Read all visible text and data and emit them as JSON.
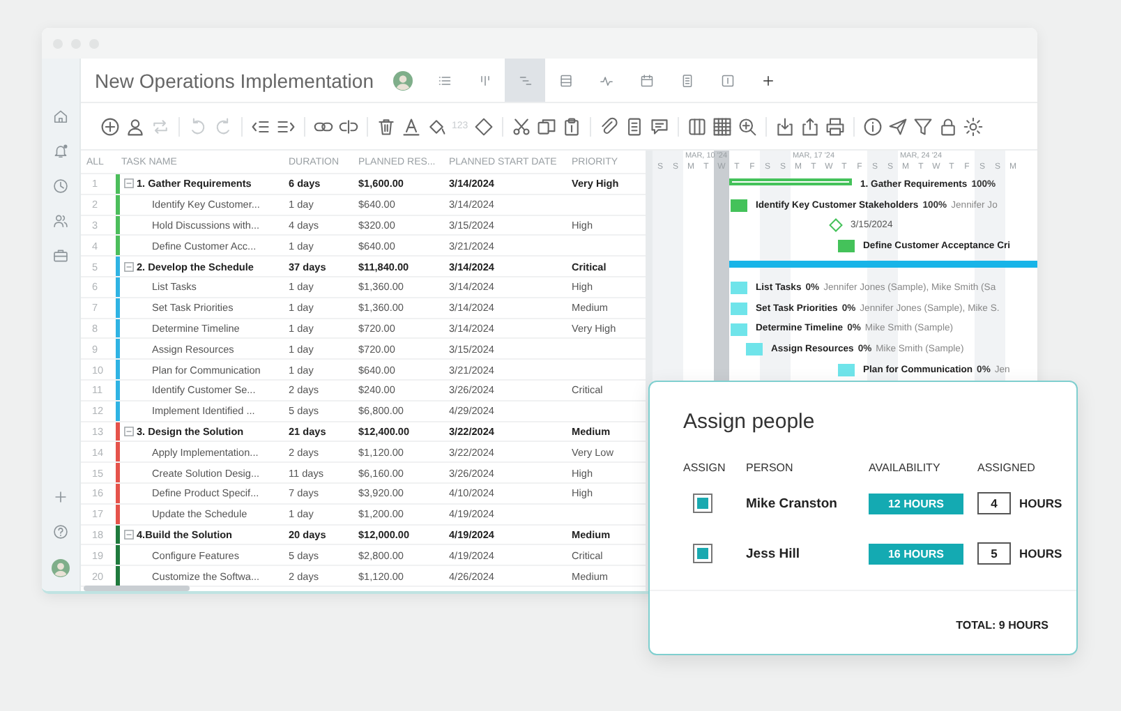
{
  "window": {
    "title": "New Operations Implementation"
  },
  "sidebar": {
    "items": [
      {
        "kind": "home"
      },
      {
        "kind": "bell"
      },
      {
        "kind": "clock"
      },
      {
        "kind": "people"
      },
      {
        "kind": "briefcase"
      }
    ],
    "bottom": [
      {
        "kind": "plus"
      },
      {
        "kind": "help"
      },
      {
        "kind": "avatar"
      }
    ]
  },
  "views": [
    {
      "kind": "list",
      "selected": false
    },
    {
      "kind": "board",
      "selected": false
    },
    {
      "kind": "gantt",
      "selected": true
    },
    {
      "kind": "sheet",
      "selected": false
    },
    {
      "kind": "pulse",
      "selected": false
    },
    {
      "kind": "calendar",
      "selected": false
    },
    {
      "kind": "doc",
      "selected": false
    },
    {
      "kind": "panel",
      "selected": false
    },
    {
      "kind": "plus",
      "selected": false
    }
  ],
  "toolbar": [
    [
      {
        "kind": "add",
        "disabled": false
      },
      {
        "kind": "person",
        "disabled": false
      },
      {
        "kind": "repeat",
        "disabled": true
      }
    ],
    [
      {
        "kind": "undo",
        "disabled": true
      },
      {
        "kind": "redo",
        "disabled": true
      }
    ],
    [
      {
        "kind": "outdent",
        "disabled": false
      },
      {
        "kind": "indent",
        "disabled": false
      }
    ],
    [
      {
        "kind": "link",
        "disabled": false
      },
      {
        "kind": "unlink",
        "disabled": false
      }
    ],
    [
      {
        "kind": "trash",
        "disabled": false
      },
      {
        "kind": "text",
        "disabled": false
      },
      {
        "kind": "bucket",
        "disabled": false
      },
      {
        "kind": "number",
        "label": "123",
        "disabled": true
      },
      {
        "kind": "diamond",
        "disabled": false
      }
    ],
    [
      {
        "kind": "scissors",
        "disabled": false
      },
      {
        "kind": "copy",
        "disabled": false
      },
      {
        "kind": "paste",
        "disabled": false
      }
    ],
    [
      {
        "kind": "attach",
        "disabled": false
      },
      {
        "kind": "doc",
        "disabled": false
      },
      {
        "kind": "comment",
        "disabled": false
      }
    ],
    [
      {
        "kind": "columns",
        "disabled": false
      },
      {
        "kind": "grid",
        "disabled": false
      },
      {
        "kind": "zoom",
        "disabled": false
      }
    ],
    [
      {
        "kind": "import",
        "disabled": false
      },
      {
        "kind": "export",
        "disabled": false
      },
      {
        "kind": "print",
        "disabled": false
      }
    ],
    [
      {
        "kind": "info",
        "disabled": false
      },
      {
        "kind": "send",
        "disabled": false
      },
      {
        "kind": "filter",
        "disabled": false
      },
      {
        "kind": "lock",
        "disabled": false
      },
      {
        "kind": "settings",
        "disabled": false
      }
    ]
  ],
  "table": {
    "columns": [
      "ALL",
      "TASK NAME",
      "DURATION",
      "PLANNED RES...",
      "PLANNED START DATE",
      "PRIORITY"
    ],
    "groups": [
      {
        "num": "1",
        "name": "1. Gather Requirements",
        "duration": "6 days",
        "cost": "$1,600.00",
        "start": "3/14/2024",
        "priority": "Very High",
        "color": "#4cbe5c",
        "expanded": true,
        "children": [
          {
            "num": "2",
            "name": "Identify Key Customer...",
            "duration": "1 day",
            "cost": "$640.00",
            "start": "3/14/2024"
          },
          {
            "num": "3",
            "name": "Hold Discussions with...",
            "duration": "4 days",
            "cost": "$320.00",
            "start": "3/15/2024",
            "priority": "High"
          },
          {
            "num": "4",
            "name": "Define Customer Acc...",
            "duration": "1 day",
            "cost": "$640.00",
            "start": "3/21/2024"
          }
        ]
      },
      {
        "num": "5",
        "name": "2. Develop the Schedule",
        "duration": "37 days",
        "cost": "$11,840.00",
        "start": "3/14/2024",
        "priority": "Critical",
        "color": "#2fb3e3",
        "expanded": true,
        "children": [
          {
            "num": "6",
            "name": "List Tasks",
            "duration": "1 day",
            "cost": "$1,360.00",
            "start": "3/14/2024",
            "priority": "High"
          },
          {
            "num": "7",
            "name": "Set Task Priorities",
            "duration": "1 day",
            "cost": "$1,360.00",
            "start": "3/14/2024",
            "priority": "Medium"
          },
          {
            "num": "8",
            "name": "Determine Timeline",
            "duration": "1 day",
            "cost": "$720.00",
            "start": "3/14/2024",
            "priority": "Very High"
          },
          {
            "num": "9",
            "name": "Assign Resources",
            "duration": "1 day",
            "cost": "$720.00",
            "start": "3/15/2024"
          },
          {
            "num": "10",
            "name": "Plan for Communication",
            "duration": "1 day",
            "cost": "$640.00",
            "start": "3/21/2024"
          },
          {
            "num": "11",
            "name": "Identify Customer Se...",
            "duration": "2 days",
            "cost": "$240.00",
            "start": "3/26/2024",
            "priority": "Critical"
          },
          {
            "num": "12",
            "name": "Implement Identified ...",
            "duration": "5 days",
            "cost": "$6,800.00",
            "start": "4/29/2024"
          }
        ]
      },
      {
        "num": "13",
        "name": "3. Design the Solution",
        "duration": "21 days",
        "cost": "$12,400.00",
        "start": "3/22/2024",
        "priority": "Medium",
        "color": "#e5534b",
        "expanded": true,
        "children": [
          {
            "num": "14",
            "name": "Apply Implementation...",
            "duration": "2 days",
            "cost": "$1,120.00",
            "start": "3/22/2024",
            "priority": "Very Low"
          },
          {
            "num": "15",
            "name": "Create Solution Desig...",
            "duration": "11 days",
            "cost": "$6,160.00",
            "start": "3/26/2024",
            "priority": "High"
          },
          {
            "num": "16",
            "name": "Define Product Specif...",
            "duration": "7 days",
            "cost": "$3,920.00",
            "start": "4/10/2024",
            "priority": "High"
          },
          {
            "num": "17",
            "name": "Update the Schedule",
            "duration": "1 day",
            "cost": "$1,200.00",
            "start": "4/19/2024"
          }
        ]
      },
      {
        "num": "18",
        "name": "4.Build the Solution",
        "duration": "20 days",
        "cost": "$12,000.00",
        "start": "4/19/2024",
        "priority": "Medium",
        "color": "#1f7a3d",
        "expanded": true,
        "children": [
          {
            "num": "19",
            "name": "Configure Features",
            "duration": "5 days",
            "cost": "$2,800.00",
            "start": "4/19/2024",
            "priority": "Critical"
          },
          {
            "num": "20",
            "name": "Customize the Softwa...",
            "duration": "2 days",
            "cost": "$1,120.00",
            "start": "4/26/2024",
            "priority": "Medium"
          }
        ]
      }
    ]
  },
  "gantt": {
    "weeks": [
      "MAR, 10 '24",
      "MAR, 17 '24",
      "MAR, 24 '24"
    ],
    "days": [
      {
        "label": "S",
        "weekend": true,
        "today": false
      },
      {
        "label": "S",
        "weekend": true,
        "today": false
      },
      {
        "label": "M",
        "weekend": false,
        "today": false
      },
      {
        "label": "T",
        "weekend": false,
        "today": false
      },
      {
        "label": "W",
        "weekend": false,
        "today": true
      },
      {
        "label": "T",
        "weekend": false,
        "today": false
      },
      {
        "label": "F",
        "weekend": false,
        "today": false
      },
      {
        "label": "S",
        "weekend": true,
        "today": false
      },
      {
        "label": "S",
        "weekend": true,
        "today": false
      },
      {
        "label": "M",
        "weekend": false,
        "today": false
      },
      {
        "label": "T",
        "weekend": false,
        "today": false
      },
      {
        "label": "W",
        "weekend": false,
        "today": false
      },
      {
        "label": "T",
        "weekend": false,
        "today": false
      },
      {
        "label": "F",
        "weekend": false,
        "today": false
      },
      {
        "label": "S",
        "weekend": true,
        "today": false
      },
      {
        "label": "S",
        "weekend": true,
        "today": false
      },
      {
        "label": "M",
        "weekend": false,
        "today": false
      },
      {
        "label": "T",
        "weekend": false,
        "today": false
      },
      {
        "label": "W",
        "weekend": false,
        "today": false
      },
      {
        "label": "T",
        "weekend": false,
        "today": false
      },
      {
        "label": "F",
        "weekend": false,
        "today": false
      },
      {
        "label": "S",
        "weekend": true,
        "today": false
      },
      {
        "label": "S",
        "weekend": true,
        "today": false
      },
      {
        "label": "M",
        "weekend": false,
        "today": false
      }
    ],
    "rows": [
      {
        "kind": "summary",
        "color": "#44c25a",
        "name": "1. Gather Requirements",
        "percent": "100%"
      },
      {
        "kind": "task",
        "color": "#44c25a",
        "name": "Identify Key Customer Stakeholders",
        "percent": "100%",
        "resources": "Jennifer Jo"
      },
      {
        "kind": "milestone",
        "color": "#44c25a",
        "name": "3/15/2024"
      },
      {
        "kind": "task",
        "color": "#44c25a",
        "name": "Define Customer Acceptance Cri"
      },
      {
        "kind": "summary",
        "color": "#18b4e8"
      },
      {
        "kind": "task",
        "color": "#6fe4ea",
        "name": "List Tasks",
        "percent": "0%",
        "resources": "Jennifer Jones (Sample), Mike Smith (Sa"
      },
      {
        "kind": "task",
        "color": "#6fe4ea",
        "name": "Set Task Priorities",
        "percent": "0%",
        "resources": "Jennifer Jones (Sample), Mike S."
      },
      {
        "kind": "task",
        "color": "#6fe4ea",
        "name": "Determine Timeline",
        "percent": "0%",
        "resources": "Mike Smith (Sample)"
      },
      {
        "kind": "task",
        "color": "#6fe4ea",
        "name": "Assign Resources",
        "percent": "0%",
        "resources": "Mike Smith (Sample)"
      },
      {
        "kind": "task",
        "color": "#6fe4ea",
        "name": "Plan for Communication",
        "percent": "0%",
        "resources": "Jen"
      }
    ]
  },
  "popup": {
    "title": "Assign people",
    "columns": [
      "ASSIGN",
      "PERSON",
      "AVAILABILITY",
      "ASSIGNED"
    ],
    "people": [
      {
        "checked": true,
        "name": "Mike Cranston",
        "availability": "12 HOURS",
        "assigned": "4",
        "unit": "HOURS"
      },
      {
        "checked": true,
        "name": "Jess Hill",
        "availability": "16 HOURS",
        "assigned": "5",
        "unit": "HOURS"
      }
    ],
    "total": "TOTAL: 9 HOURS"
  }
}
